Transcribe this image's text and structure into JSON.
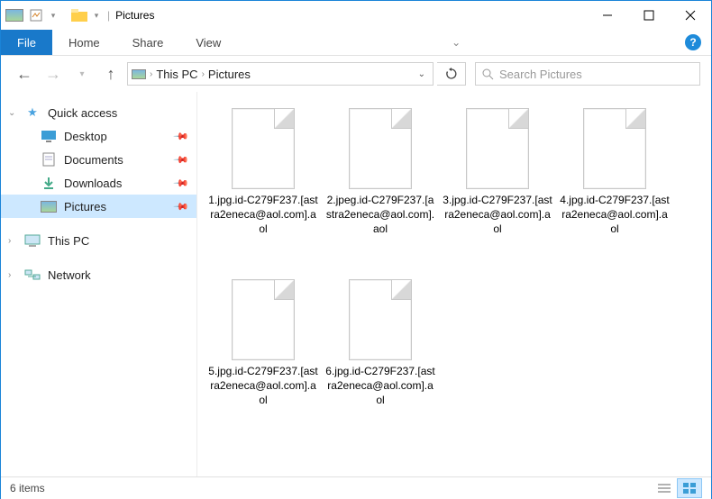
{
  "window": {
    "title": "Pictures"
  },
  "ribbon": {
    "file": "File",
    "tabs": [
      "Home",
      "Share",
      "View"
    ]
  },
  "breadcrumb": {
    "items": [
      "This PC",
      "Pictures"
    ]
  },
  "search": {
    "placeholder": "Search Pictures"
  },
  "navpane": {
    "quick_access": {
      "label": "Quick access",
      "items": [
        {
          "label": "Desktop",
          "icon": "desktop",
          "pinned": true
        },
        {
          "label": "Documents",
          "icon": "documents",
          "pinned": true
        },
        {
          "label": "Downloads",
          "icon": "downloads",
          "pinned": true
        },
        {
          "label": "Pictures",
          "icon": "pictures",
          "pinned": true,
          "selected": true
        }
      ]
    },
    "this_pc": {
      "label": "This PC"
    },
    "network": {
      "label": "Network"
    }
  },
  "files": [
    {
      "name": "1.jpg.id-C279F237.[astra2eneca@aol.com].aol"
    },
    {
      "name": "2.jpeg.id-C279F237.[astra2eneca@aol.com].aol"
    },
    {
      "name": "3.jpg.id-C279F237.[astra2eneca@aol.com].aol"
    },
    {
      "name": "4.jpg.id-C279F237.[astra2eneca@aol.com].aol"
    },
    {
      "name": "5.jpg.id-C279F237.[astra2eneca@aol.com].aol"
    },
    {
      "name": "6.jpg.id-C279F237.[astra2eneca@aol.com].aol"
    }
  ],
  "status": {
    "count_label": "6 items"
  }
}
